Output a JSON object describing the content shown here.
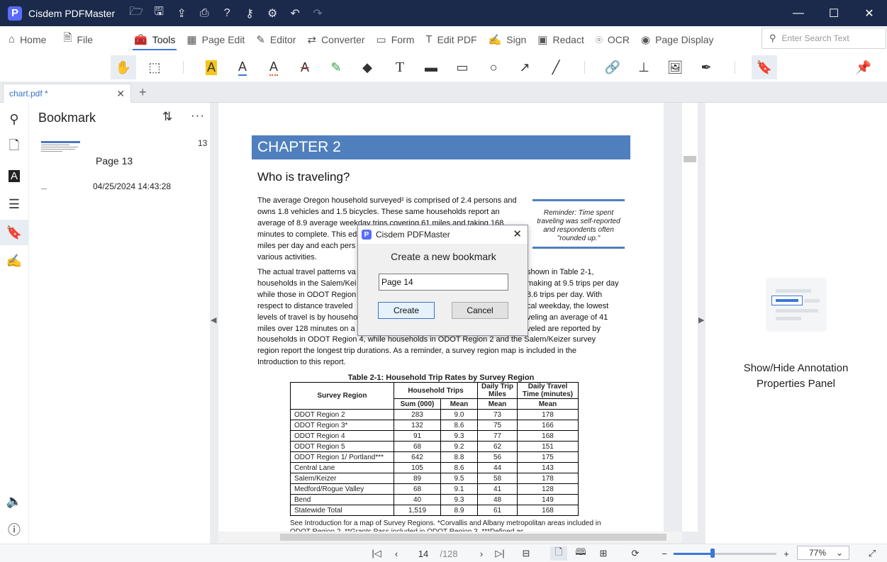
{
  "app": {
    "title": "Cisdem PDFMaster",
    "logo_letter": "P"
  },
  "menu": {
    "items": [
      {
        "label": "Home",
        "icon": "home-icon"
      },
      {
        "label": "File",
        "icon": "file-icon"
      },
      {
        "label": "Tools",
        "icon": "toolbox-icon"
      },
      {
        "label": "Page Edit",
        "icon": "grid-icon"
      },
      {
        "label": "Editor",
        "icon": "edit-icon"
      },
      {
        "label": "Converter",
        "icon": "convert-icon"
      },
      {
        "label": "Form",
        "icon": "form-icon"
      },
      {
        "label": "Edit PDF",
        "icon": "text-cursor-icon"
      },
      {
        "label": "Sign",
        "icon": "sign-icon"
      },
      {
        "label": "Redact",
        "icon": "redact-icon"
      },
      {
        "label": "OCR",
        "icon": "ocr-icon"
      },
      {
        "label": "Page Display",
        "icon": "eye-icon"
      }
    ],
    "search_placeholder": "Enter Search Text"
  },
  "tabs": {
    "doc_name": "chart.pdf *"
  },
  "bookmark_panel": {
    "title": "Bookmark",
    "items": [
      {
        "label": "Page 13",
        "page": "13",
        "date": "04/25/2024 14:43:28"
      }
    ]
  },
  "document": {
    "chapter": "CHAPTER 2",
    "heading": "Who is traveling?",
    "para1_lines": [
      "The average Oregon household surveyed² is comprised of 2.4 persons and",
      "owns 1.8 vehicles and 1.5 bicycles. These same households report an",
      "average of 8.9 average weekday trips covering 61 miles and taking 168",
      "minutes to complete. This ed",
      "miles per day and each pers",
      "various activities."
    ],
    "para2_lines": [
      "The actual travel patterns va",
      "households in the Salem/Kei",
      "while those in ODOT Region",
      "respect to distance traveled",
      "levels of travel is by househo",
      "miles over 128 minutes on a"
    ],
    "para2_right_lines": [
      "shown in Table 2-1,",
      "making at 9.5 trips per day",
      "8.6 trips per day. With",
      "cal weekday, the lowest",
      "veling an average of 41",
      "veled are reported by"
    ],
    "para3_lines": [
      "households in ODOT Region 4, while households in ODOT Region 2 and the Salem/Keizer survey",
      "region report the longest trip durations. As a reminder, a survey region map is included in the",
      "Introduction to this report."
    ],
    "note": "Reminder:  Time spent traveling was self-reported and respondents often \"rounded up.\"",
    "table_caption": "Table 2-1:  Household Trip Rates by Survey Region",
    "table_headers": {
      "region": "Survey Region",
      "household_trips": "Household Trips",
      "daily_trip_miles": "Daily Trip Miles",
      "daily_travel_time": "Daily Travel Time (minutes)",
      "sum": "Sum (000)",
      "mean": "Mean"
    },
    "table_rows": [
      [
        "ODOT Region 2",
        "283",
        "9.0",
        "73",
        "178"
      ],
      [
        "ODOT Region 3*",
        "132",
        "8.6",
        "75",
        "166"
      ],
      [
        "ODOT Region 4",
        "91",
        "9.3",
        "77",
        "168"
      ],
      [
        "ODOT Region 5",
        "68",
        "9.2",
        "62",
        "151"
      ],
      [
        "ODOT Region 1/ Portland***",
        "642",
        "8.8",
        "56",
        "175"
      ],
      [
        "Central Lane",
        "105",
        "8.6",
        "44",
        "143"
      ],
      [
        "Salem/Keizer",
        "89",
        "9.5",
        "58",
        "178"
      ],
      [
        "Medford/Rogue Valley",
        "68",
        "9.1",
        "41",
        "128"
      ],
      [
        "Bend",
        "40",
        "9.3",
        "48",
        "149"
      ],
      [
        "Statewide Total",
        "1,519",
        "8.9",
        "61",
        "168"
      ]
    ],
    "footnote": "See Introduction for a map of Survey Regions. *Corvallis and Albany metropolitan areas included in ODOT Region 2. **Grants Pass included in ODOT Region 3. ***Defined as"
  },
  "right_panel": {
    "text": "Show/Hide Annotation Properties Panel"
  },
  "status": {
    "current_page": "14",
    "total_pages": "/128",
    "zoom": "77%",
    "zoom_fraction": 0.38
  },
  "dialog": {
    "title": "Cisdem PDFMaster",
    "message": "Create a new bookmark",
    "input_value": "Page 14",
    "create_label": "Create",
    "cancel_label": "Cancel"
  },
  "colors": {
    "titlebar": "#1b2a4b",
    "accent": "#3a78d8",
    "chapter_band": "#4f80bd"
  }
}
